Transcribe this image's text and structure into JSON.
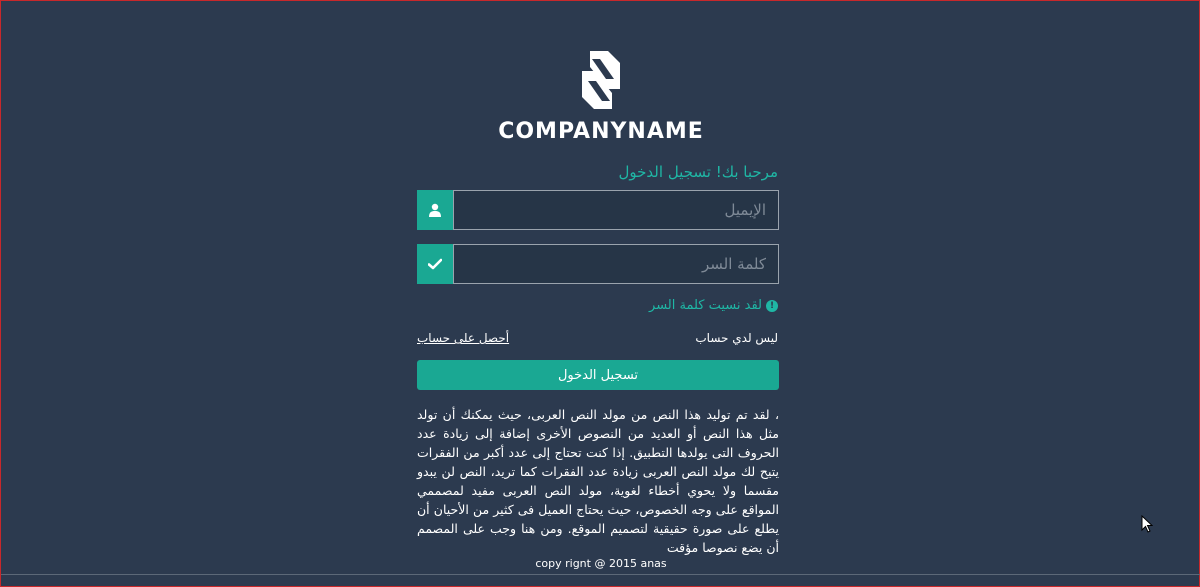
{
  "logo": {
    "icon": "company-monogram-icon",
    "text": "COMPANYNAME"
  },
  "welcome_text": "مرحبا بك! تسجيل الدخول",
  "email_field": {
    "placeholder": "الإيميل",
    "icon": "user-icon"
  },
  "password_field": {
    "placeholder": "كلمة السر",
    "icon": "check-icon"
  },
  "forgot_password": {
    "label": "لقد نسيت كلمة السر",
    "icon": "info-icon"
  },
  "no_account_text": "ليس لدي حساب",
  "get_account_link": "أحصل على حساب",
  "login_button": "تسجيل الدخول",
  "description": "، لقد تم توليد هذا النص من مولد النص العربى، حيث يمكنك أن تولد مثل هذا النص أو العديد من النصوص الأخرى إضافة إلى زيادة عدد الحروف التى يولدها التطبيق. إذا كنت تحتاج إلى عدد أكبر من الفقرات يتيح لك مولد النص العربى زيادة عدد الفقرات كما تريد، النص لن يبدو مقسما ولا يحوي أخطاء لغوية، مولد النص العربى مفيد لمصممي المواقع على وجه الخصوص، حيث يحتاج العميل فى كثير من الأحيان أن يطلع على صورة حقيقية لتصميم الموقع. ومن هنا وجب على المصمم أن يضع نصوصا مؤقت",
  "copyright": "copy rignt @ 2015 anas",
  "colors": {
    "background": "#2c3a4f",
    "accent": "#1aa893",
    "accent_text": "#1fb7a5"
  }
}
